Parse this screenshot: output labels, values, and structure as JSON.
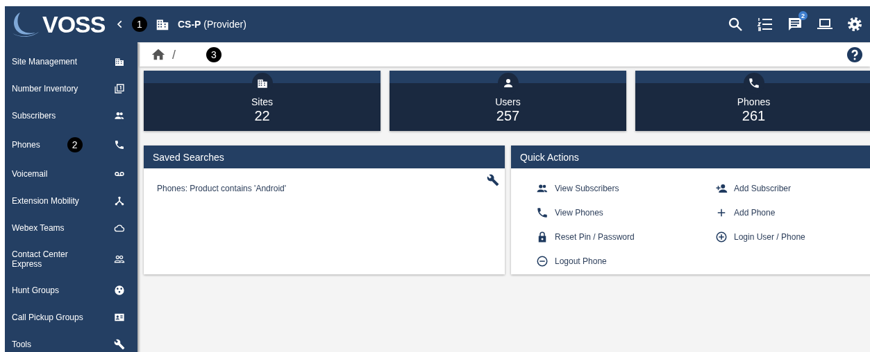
{
  "header": {
    "logo": "VOSS",
    "callout": "1",
    "context": "**CS-P** (Provider)",
    "notification_count": "2"
  },
  "sidebar": {
    "items": [
      {
        "label": "Site Management"
      },
      {
        "label": "Number Inventory"
      },
      {
        "label": "Subscribers"
      },
      {
        "label": "Phones",
        "callout": "2"
      },
      {
        "label": "Voicemail"
      },
      {
        "label": "Extension Mobility"
      },
      {
        "label": "Webex Teams"
      },
      {
        "label": "Contact Center Express"
      },
      {
        "label": "Hunt Groups"
      },
      {
        "label": "Call Pickup Groups"
      },
      {
        "label": "Tools"
      }
    ]
  },
  "breadcrumb": {
    "separator": "/",
    "callout": "3"
  },
  "stats": [
    {
      "label": "Sites",
      "value": "22"
    },
    {
      "label": "Users",
      "value": "257"
    },
    {
      "label": "Phones",
      "value": "261"
    }
  ],
  "saved_searches": {
    "title": "Saved Searches",
    "items": [
      "Phones: Product contains 'Android'"
    ]
  },
  "quick_actions": {
    "title": "Quick Actions",
    "items": [
      "View Subscribers",
      "Add Subscriber",
      "View Phones",
      "Add Phone",
      "Reset Pin / Password",
      "Login User / Phone",
      "Logout Phone"
    ]
  }
}
